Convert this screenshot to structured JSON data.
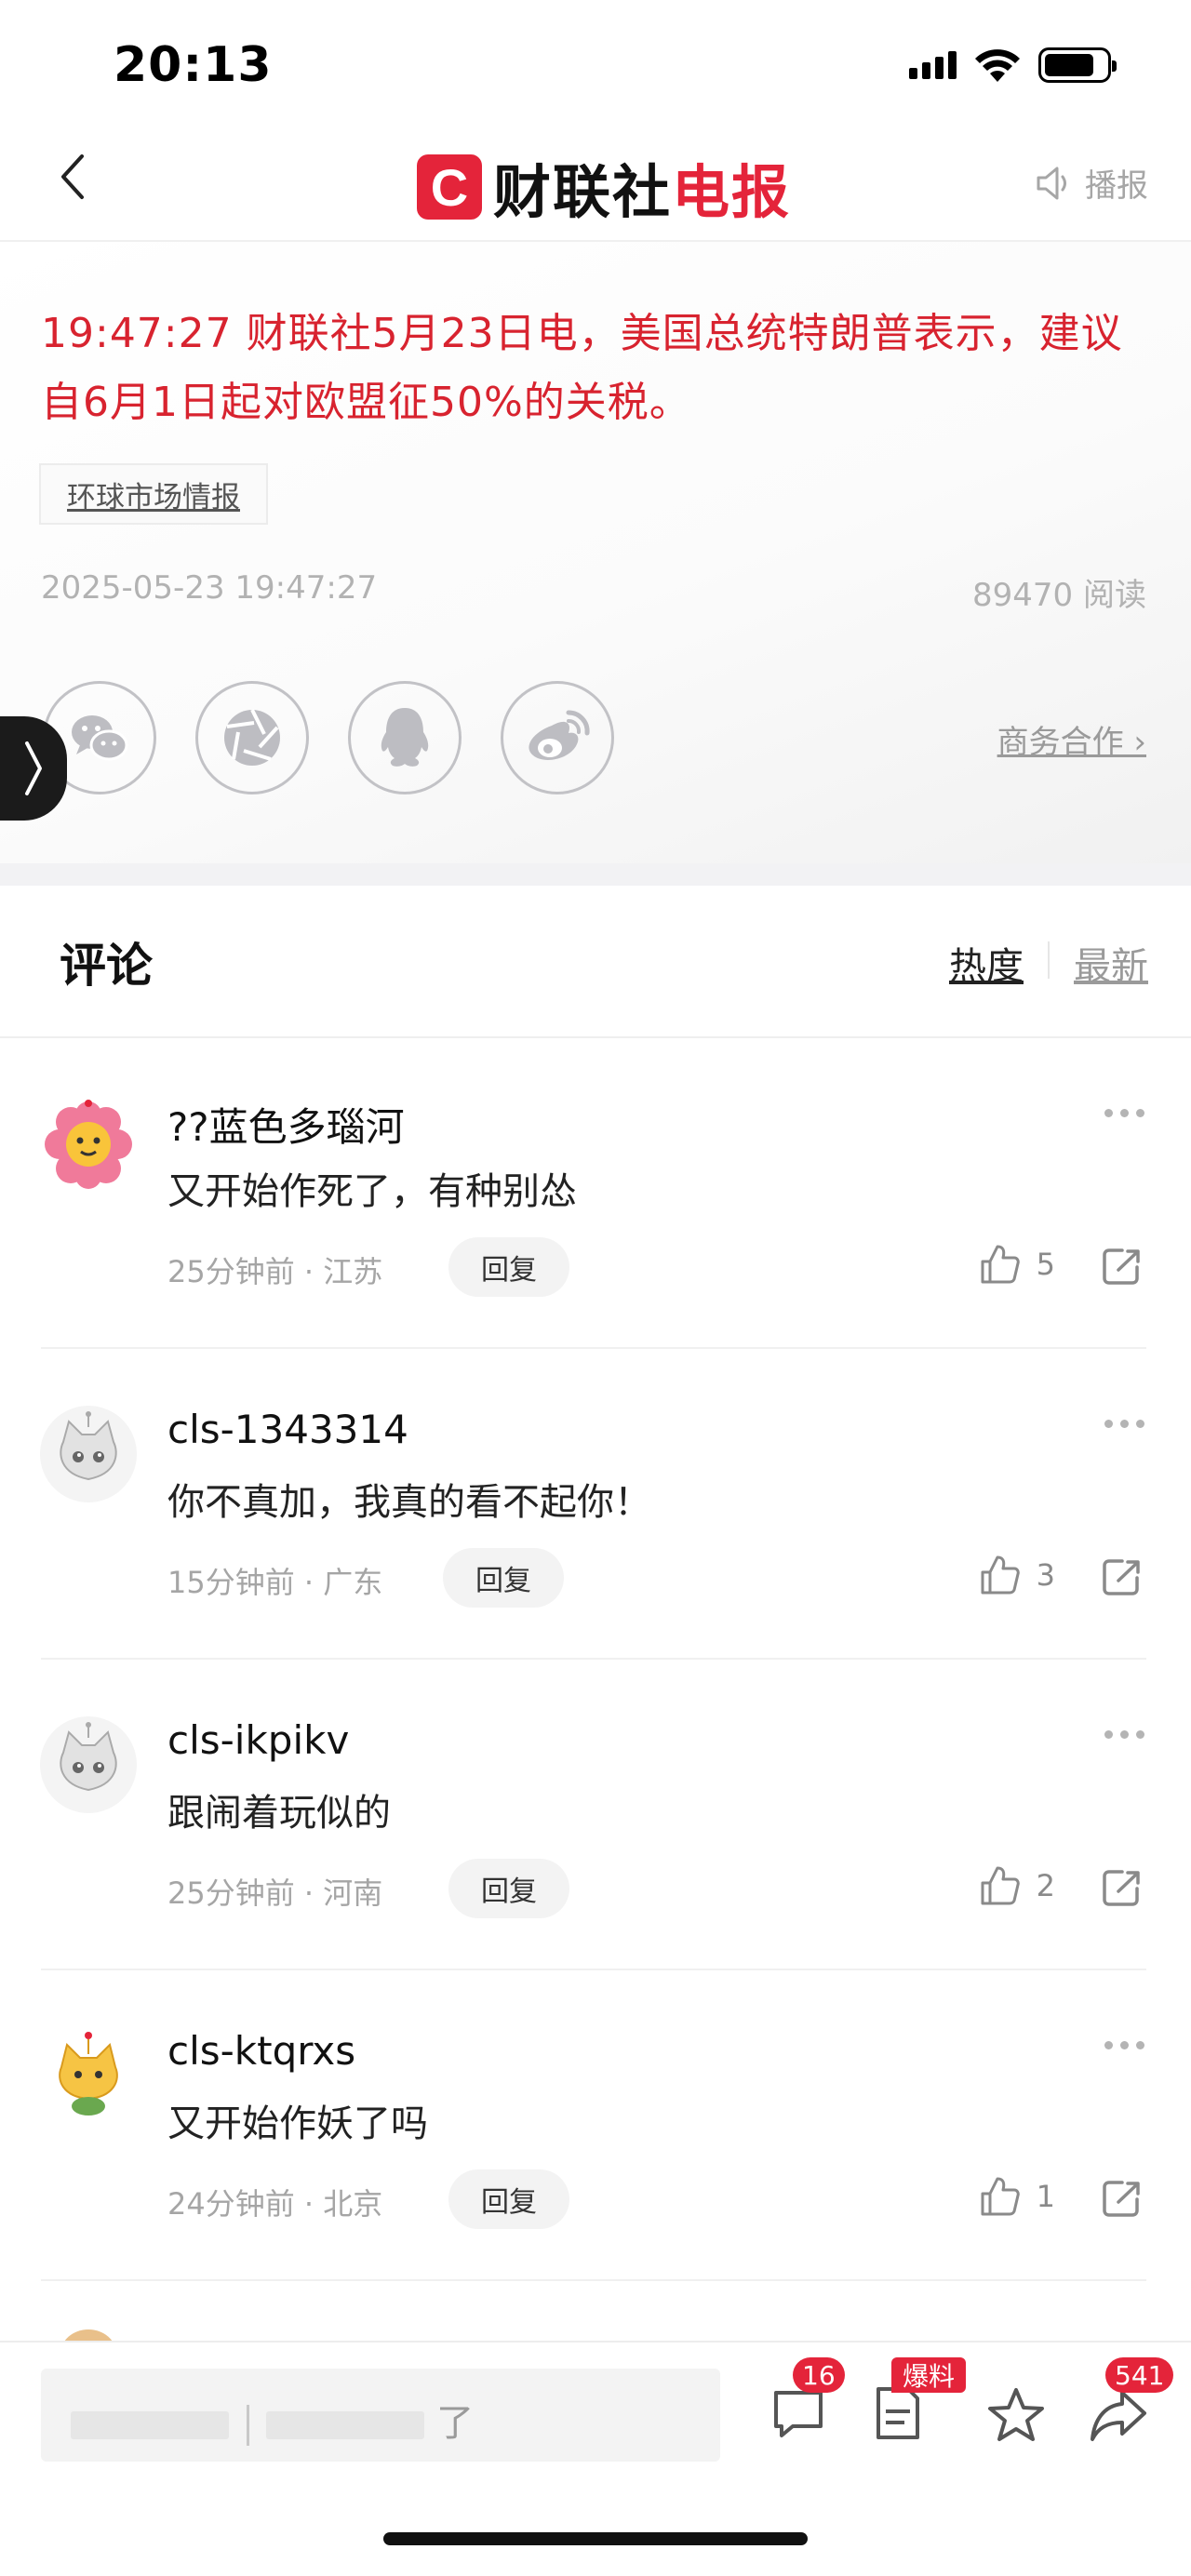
{
  "status_bar": {
    "time": "20:13"
  },
  "nav": {
    "logo_mark": "C",
    "logo_text_black": "财联社",
    "logo_text_red": "电报",
    "broadcast_label": "播报"
  },
  "article": {
    "headline": "19:47:27  财联社5月23日电，美国总统特朗普表示，建议自6月1日起对欧盟征50%的关税。",
    "tag": "环球市场情报",
    "datetime": "2025-05-23 19:47:27",
    "reads": "89470 阅读",
    "business_link": "商务合作 ›"
  },
  "comments_section": {
    "title": "评论",
    "sort_hot": "热度",
    "sort_new": "最新"
  },
  "comments": [
    {
      "user": "??蓝色多瑙河",
      "text": "又开始作死了，有种别怂",
      "meta": "25分钟前 · 江苏",
      "reply": "回复",
      "likes": "5"
    },
    {
      "user": "cls-1343314",
      "text": "你不真加，我真的看不起你！",
      "meta": "15分钟前 · 广东",
      "reply": "回复",
      "likes": "3"
    },
    {
      "user": "cls-ikpikv",
      "text": "跟闹着玩似的",
      "meta": "25分钟前 · 河南",
      "reply": "回复",
      "likes": "2"
    },
    {
      "user": "cls-ktqrxs",
      "text": "又开始作妖了吗",
      "meta": "24分钟前 · 北京",
      "reply": "回复",
      "likes": "1"
    }
  ],
  "bottom_bar": {
    "input_text": "了",
    "comments_badge": "16",
    "tip_badge": "爆料",
    "share_badge": "541"
  },
  "colors": {
    "brand_red": "#e4243a",
    "headline_red": "#d8232f"
  }
}
